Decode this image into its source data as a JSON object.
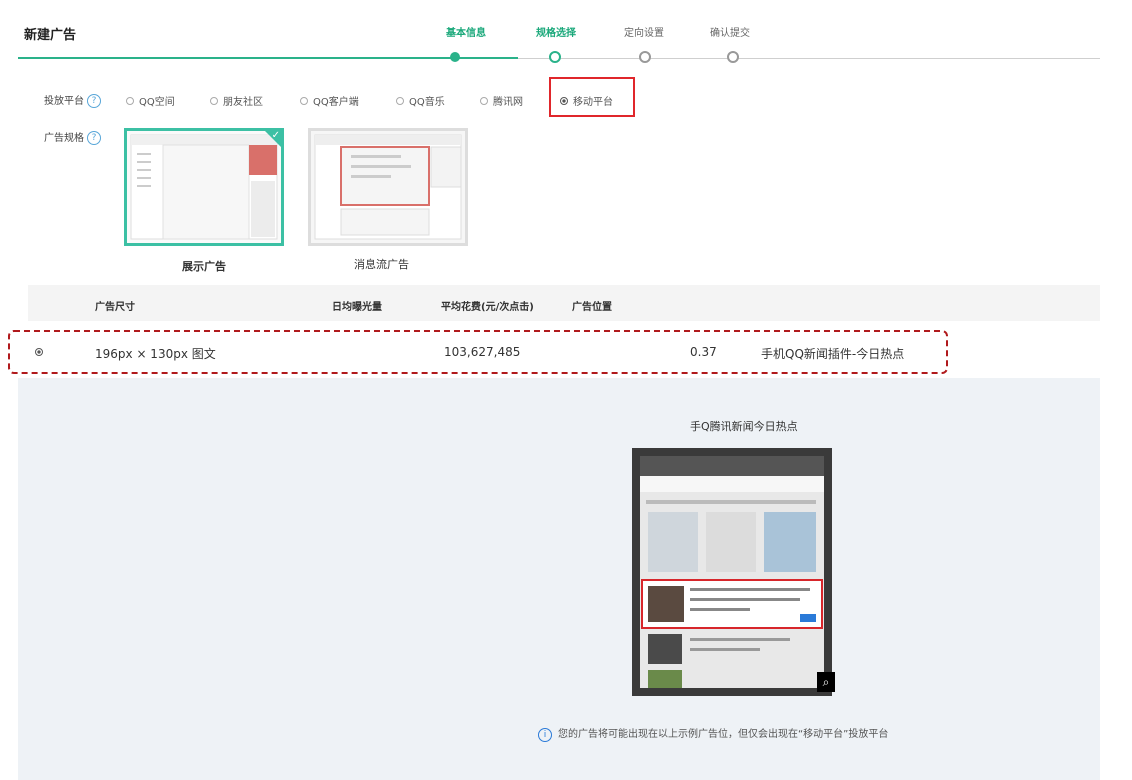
{
  "header": {
    "title": "新建广告"
  },
  "steps": [
    {
      "label": "基本信息"
    },
    {
      "label": "规格选择"
    },
    {
      "label": "定向设置"
    },
    {
      "label": "确认提交"
    }
  ],
  "platform": {
    "label": "投放平台",
    "options": [
      "QQ空间",
      "朋友社区",
      "QQ客户端",
      "QQ音乐",
      "腾讯网",
      "移动平台"
    ],
    "selected": "移动平台"
  },
  "spec": {
    "label": "广告规格",
    "cards": [
      {
        "label": "展示广告"
      },
      {
        "label": "消息流广告"
      }
    ]
  },
  "table": {
    "headers": [
      "广告尺寸",
      "日均曝光量",
      "平均花费(元/次点击)",
      "广告位置"
    ],
    "row": {
      "size": "196px × 130px 图文",
      "exposure": "103,627,485",
      "cost": "0.37",
      "position": "手机QQ新闻插件-今日热点"
    }
  },
  "preview": {
    "title": "手Q腾讯新闻今日热点",
    "note": "您的广告将可能出现在以上示例广告位，但仅会出现在“移动平台”投放平台"
  },
  "colors": {
    "accent": "#2ab28a",
    "highlight": "#e0262b",
    "dashed": "#b0191c"
  }
}
